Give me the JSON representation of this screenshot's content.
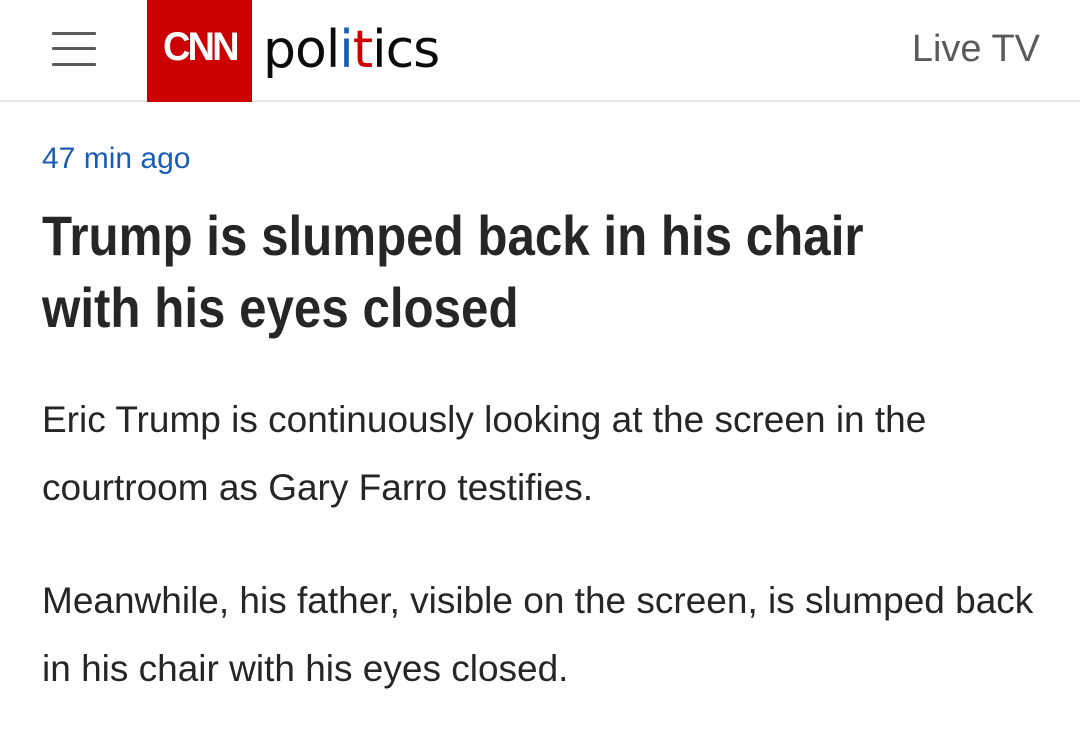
{
  "header": {
    "menu_icon": "hamburger-menu-icon",
    "logo_text": "CNN",
    "section_title_parts": [
      "pol",
      "i",
      "t",
      "ics"
    ],
    "live_tv_label": "Live TV",
    "colors": {
      "brand_red": "#cc0000",
      "accent_blue": "#1a5db4"
    }
  },
  "article": {
    "timestamp": "47 min ago",
    "headline": "Trump is slumped back in his chair with his eyes closed",
    "paragraphs": [
      "Eric Trump is continuously looking at the screen in the courtroom as Gary Farro testifies.",
      "Meanwhile, his father, visible on the screen, is slumped back in his chair with his eyes closed."
    ]
  }
}
